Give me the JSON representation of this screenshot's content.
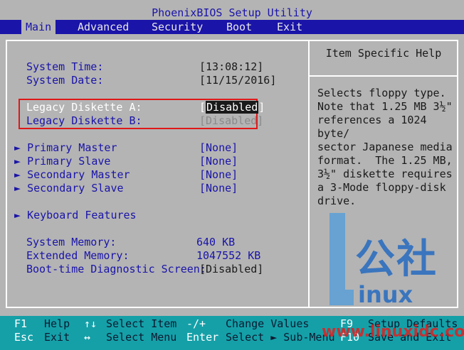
{
  "title": "PhoenixBIOS Setup Utility",
  "menu": {
    "items": [
      {
        "label": "Main",
        "active": true
      },
      {
        "label": "Advanced",
        "active": false
      },
      {
        "label": "Security",
        "active": false
      },
      {
        "label": "Boot",
        "active": false
      },
      {
        "label": "Exit",
        "active": false
      }
    ]
  },
  "settings": {
    "system_time": {
      "label": "System Time:",
      "value": "[13:08:12]"
    },
    "system_date": {
      "label": "System Date:",
      "value": "[11/15/2016]"
    },
    "diskette_a": {
      "label": "Legacy Diskette A:",
      "value_open": "[",
      "value": "Disabled",
      "value_close": "]"
    },
    "diskette_b": {
      "label": "Legacy Diskette B:",
      "value": "[Disabled]"
    },
    "primary_master": {
      "label": "Primary Master",
      "value": "[None]"
    },
    "primary_slave": {
      "label": "Primary Slave",
      "value": "[None]"
    },
    "secondary_master": {
      "label": "Secondary Master",
      "value": "[None]"
    },
    "secondary_slave": {
      "label": "Secondary Slave",
      "value": "[None]"
    },
    "keyboard_features": {
      "label": "Keyboard Features"
    },
    "system_memory": {
      "label": "System Memory:",
      "value": "640 KB"
    },
    "extended_memory": {
      "label": "Extended Memory:",
      "value": "1047552 KB"
    },
    "boot_diag": {
      "label": "Boot-time Diagnostic Screen:",
      "value": "[Disabled]"
    },
    "submenu_arrow": "►"
  },
  "help": {
    "title": "Item Specific Help",
    "text": "Selects floppy type.\nNote that 1.25 MB 3½\"\nreferences a 1024 byte/\nsector Japanese media\nformat.  The 1.25 MB,\n3½\" diskette requires\na 3-Mode floppy-disk\ndrive."
  },
  "statusbar": {
    "f1_key": "F1",
    "f1_label": "Help",
    "esc_key": "Esc",
    "esc_label": "Exit",
    "updown_key": "↑↓",
    "updown_label": "Select Item",
    "leftright_key": "↔",
    "leftright_label": "Select Menu",
    "plusminus_key": "-/+",
    "plusminus_label": "Change Values",
    "enter_key": "Enter",
    "enter_label": "Select ► Sub-Menu",
    "f9_key": "F9",
    "f9_label": "Setup Defaults",
    "f10_key": "F10",
    "f10_label": "Save and Exit"
  },
  "watermark": {
    "brand": "公社",
    "inux": "inux",
    "url": "www.linuxidc.com"
  },
  "colors": {
    "background": "#b4b4b4",
    "accent_blue": "#1a14a8",
    "status_cyan": "#15a0a8",
    "highlight_red": "#e01818"
  }
}
